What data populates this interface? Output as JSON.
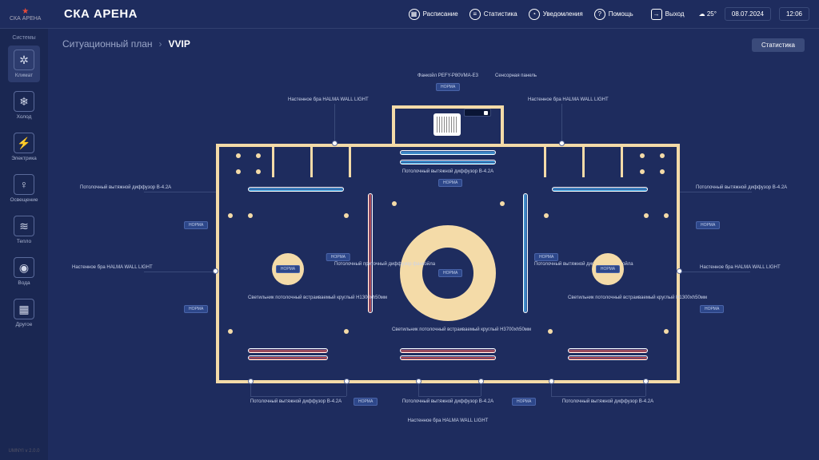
{
  "brand": "СКА АРЕНА",
  "logo_sub": "СКА АРЕНА",
  "header_nav": {
    "schedule": "Расписание",
    "stats": "Статистика",
    "notif": "Уведомления",
    "help": "Помощь",
    "exit": "Выход"
  },
  "meta": {
    "temp": "25°",
    "date": "08.07.2024",
    "time": "12:06"
  },
  "sidebar": {
    "category": "Системы",
    "items": [
      {
        "label": "Климат"
      },
      {
        "label": "Холод"
      },
      {
        "label": "Электрика"
      },
      {
        "label": "Освещение"
      },
      {
        "label": "Тепло"
      },
      {
        "label": "Вода"
      },
      {
        "label": "Другое"
      }
    ],
    "footer": "UMNYI v 2.0.0"
  },
  "breadcrumb": {
    "root": "Ситуационный план",
    "current": "VVIP"
  },
  "buttons": {
    "statistics": "Статистика"
  },
  "labels": {
    "fancoil": "Фанкойл PEFY-P80VMA-E3",
    "sensor_panel": "Сенсорная панель",
    "wall_light": "Настенное бра HALMA WALL LIGHT",
    "ceil_ext_b42a": "Потолочный вытяжной диффузор B-4.2A",
    "ceil_lamp_big": "Светильник потолочный встраиваемый круглый H3700xh50мм",
    "ceil_lamp_sm": "Светильник потолочный встраиваемый круглый H1300xh50мм",
    "supply_diff": "Потолочный приточный диффузор фанкойла",
    "ext_diff": "Потолочный вытяжной диффузор фанкойла",
    "norm": "НОРМА"
  }
}
